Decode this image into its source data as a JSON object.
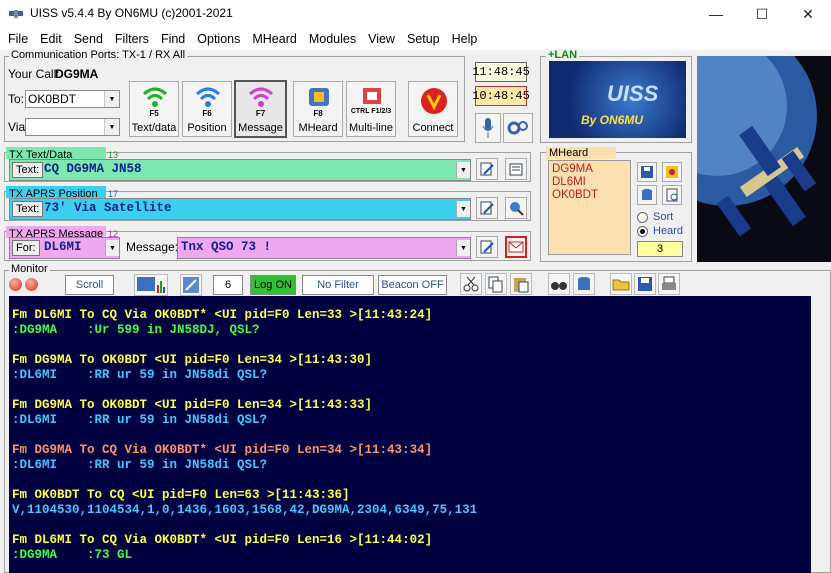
{
  "window": {
    "title": "UISS v5.4.4 By ON6MU (c)2001-2021",
    "min_glyph": "—",
    "max_glyph": "☐",
    "close_glyph": "✕"
  },
  "menu": [
    "File",
    "Edit",
    "Send",
    "Filters",
    "Find",
    "Options",
    "MHeard",
    "Modules",
    "View",
    "Setup",
    "Help"
  ],
  "comm": {
    "header": "Communication Ports: TX-1 / RX All",
    "your_call_label": "Your Call:",
    "your_call": "DG9MA",
    "to_label": "To:",
    "to_value": "OK0BDT",
    "via_label": "Via:",
    "via_value": ""
  },
  "fbuttons": [
    {
      "key": "F5",
      "label": "Text/data"
    },
    {
      "key": "F6",
      "label": "Position"
    },
    {
      "key": "F7",
      "label": "Message"
    },
    {
      "key": "F8",
      "label": "MHeard"
    },
    {
      "key": "CTRL F1/2/3",
      "label": "Multi-line"
    },
    {
      "key": "",
      "label": "Connect"
    }
  ],
  "clocks": {
    "utc": "11:48:45",
    "local": "10:48:45"
  },
  "lan_label": "+LAN",
  "logo_text": "By ON6MU",
  "logo_big": "UISS",
  "tx_text": {
    "header": "TX Text/Data",
    "count": "13",
    "field_label": "Text:",
    "value": "CQ DG9MA JN58"
  },
  "tx_pos": {
    "header": "TX APRS Position",
    "count": "17",
    "field_label": "Text:",
    "value": "73' Via Satellite"
  },
  "tx_msg": {
    "header": "TX APRS Message",
    "count": "12",
    "for_label": "For:",
    "for_value": "DL6MI",
    "msg_label": "Message:",
    "msg_value": "Tnx QSO 73 !"
  },
  "mheard": {
    "header": "MHeard",
    "calls": [
      "DG9MA",
      "DL6MI",
      "OK0BDT"
    ],
    "sort_label": "Sort",
    "heard_label": "Heard",
    "count": "3"
  },
  "monitor": {
    "label": "Monitor",
    "scroll": "Scroll",
    "lines_count": "6",
    "log": "Log ON",
    "filter": "No Filter",
    "beacon": "Beacon OFF"
  },
  "log_lines": [
    {
      "text": "Fm DL6MI To CQ Via OK0BDT* <UI pid=F0 Len=33 >[11:43:24]",
      "color": "yellow"
    },
    {
      "text": ":DG9MA    :Ur 599 in JN58DJ, QSL?",
      "color": "green"
    },
    {
      "text": "",
      "color": "yellow"
    },
    {
      "text": "Fm DG9MA To OK0BDT <UI pid=F0 Len=34 >[11:43:30]",
      "color": "yellow"
    },
    {
      "text": ":DL6MI    :RR ur 59 in JN58di QSL?",
      "color": "cyan"
    },
    {
      "text": "",
      "color": "yellow"
    },
    {
      "text": "Fm DG9MA To OK0BDT <UI pid=F0 Len=34 >[11:43:33]",
      "color": "yellow"
    },
    {
      "text": ":DL6MI    :RR ur 59 in JN58di QSL?",
      "color": "cyan"
    },
    {
      "text": "",
      "color": "yellow"
    },
    {
      "text": "Fm DG9MA To CQ Via OK0BDT* <UI pid=F0 Len=34 >[11:43:34]",
      "color": "salmon"
    },
    {
      "text": ":DL6MI    :RR ur 59 in JN58di QSL?",
      "color": "cyan"
    },
    {
      "text": "",
      "color": "yellow"
    },
    {
      "text": "Fm OK0BDT To CQ <UI pid=F0 Len=63 >[11:43:36]",
      "color": "yellow"
    },
    {
      "text": "V,1104530,1104534,1,0,1436,1603,1568,42,DG9MA,2304,6349,75,131",
      "color": "cyan"
    },
    {
      "text": "",
      "color": "yellow"
    },
    {
      "text": "Fm DL6MI To CQ Via OK0BDT* <UI pid=F0 Len=16 >[11:44:02]",
      "color": "yellow"
    },
    {
      "text": ":DG9MA    :73 GL",
      "color": "green"
    }
  ],
  "colors": {
    "text_bar": "#7de8b0",
    "pos_bar": "#3cd0f0",
    "msg_bar": "#f0a8f0",
    "mheard_bg": "#fde0b0",
    "monitor_bg": "#000040"
  }
}
